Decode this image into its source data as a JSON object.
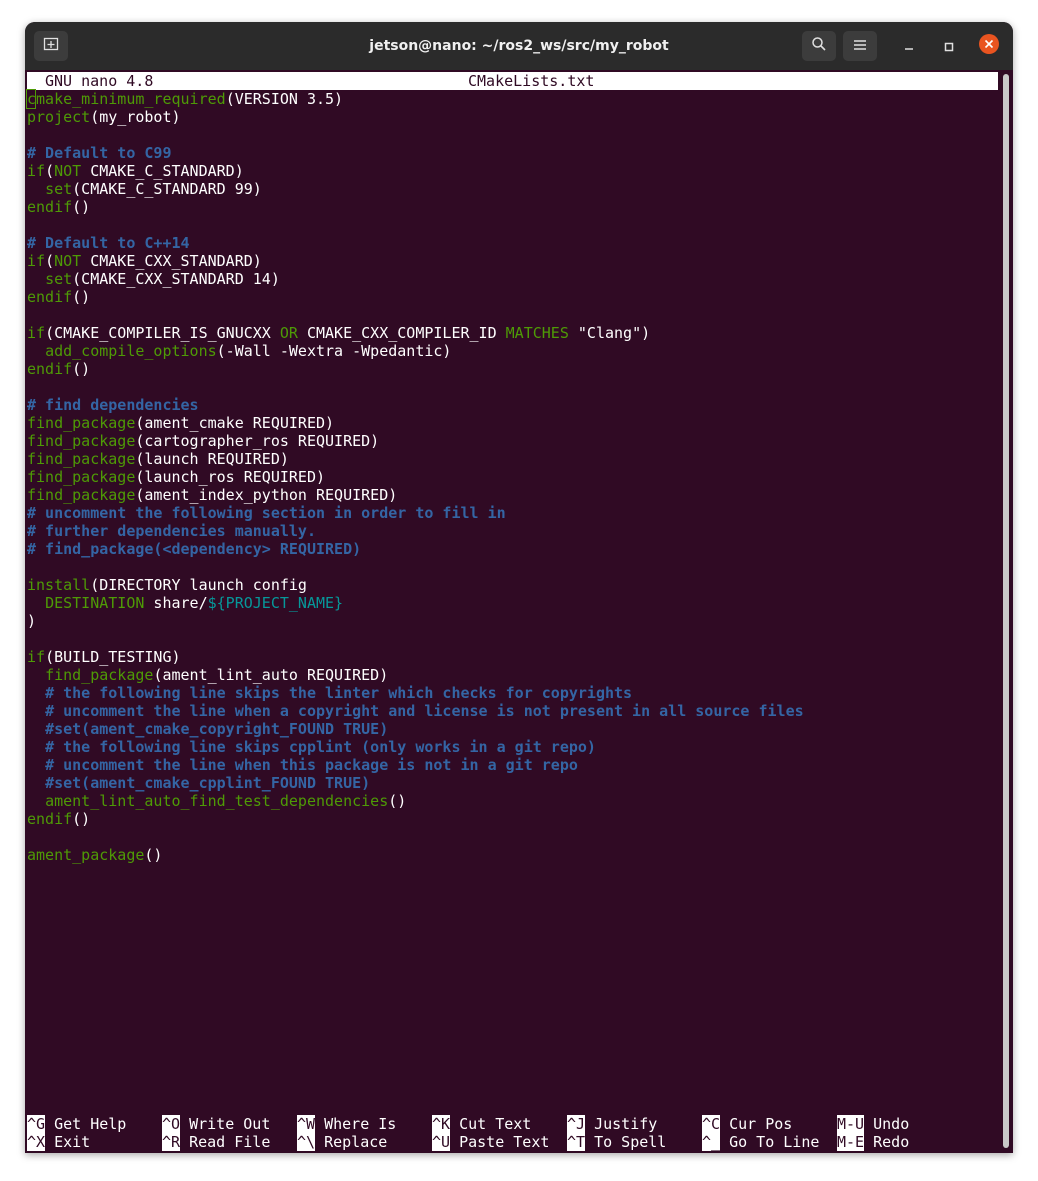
{
  "window": {
    "title": "jetson@nano: ~/ros2_ws/src/my_robot",
    "new_tab_icon": "new-tab-icon",
    "search_icon": "search-icon",
    "menu_icon": "hamburger-menu-icon",
    "minimize_icon": "minimize-icon",
    "maximize_icon": "maximize-icon",
    "close_icon": "close-icon",
    "close_color": "#e95420"
  },
  "nano": {
    "version": "GNU nano 4.8",
    "filename": "CMakeLists.txt"
  },
  "code": {
    "l1a": "cmake_minimum_required",
    "l1b": "(VERSION 3.5)",
    "l2a": "project",
    "l2b": "(my_robot)",
    "l4": "# Default to C99",
    "l5a": "if",
    "l5b": "(",
    "l5c": "NOT",
    "l5d": " CMAKE_C_STANDARD)",
    "l6a": "set",
    "l6b": "(CMAKE_C_STANDARD 99)",
    "l7a": "endif",
    "l7b": "()",
    "l9": "# Default to C++14",
    "l10a": "if",
    "l10b": "(",
    "l10c": "NOT",
    "l10d": " CMAKE_CXX_STANDARD)",
    "l11a": "set",
    "l11b": "(CMAKE_CXX_STANDARD 14)",
    "l12a": "endif",
    "l12b": "()",
    "l14a": "if",
    "l14b": "(CMAKE_COMPILER_IS_GNUCXX ",
    "l14c": "OR",
    "l14d": " CMAKE_CXX_COMPILER_ID ",
    "l14e": "MATCHES",
    "l14f": " \"Clang\")",
    "l15a": "add_compile_options",
    "l15b": "(-Wall -Wextra -Wpedantic)",
    "l16a": "endif",
    "l16b": "()",
    "l18": "# find dependencies",
    "l19a": "find_package",
    "l19b": "(ament_cmake REQUIRED)",
    "l20a": "find_package",
    "l20b": "(cartographer_ros REQUIRED)",
    "l21a": "find_package",
    "l21b": "(launch REQUIRED)",
    "l22a": "find_package",
    "l22b": "(launch_ros REQUIRED)",
    "l23a": "find_package",
    "l23b": "(ament_index_python REQUIRED)",
    "l24": "# uncomment the following section in order to fill in",
    "l25": "# further dependencies manually.",
    "l26": "# find_package(<dependency> REQUIRED)",
    "l28a": "install",
    "l28b": "(DIRECTORY launch config",
    "l29a": "DESTINATION",
    "l29b": " share/",
    "l29c": "${PROJECT_NAME}",
    "l30": ")",
    "l32a": "if",
    "l32b": "(BUILD_TESTING)",
    "l33a": "find_package",
    "l33b": "(ament_lint_auto REQUIRED)",
    "l34": "# the following line skips the linter which checks for copyrights",
    "l35": "# uncomment the line when a copyright and license is not present in all source files",
    "l36": "#set(ament_cmake_copyright_FOUND TRUE)",
    "l37": "# the following line skips cpplint (only works in a git repo)",
    "l38": "# uncomment the line when this package is not in a git repo",
    "l39": "#set(ament_cmake_cpplint_FOUND TRUE)",
    "l40a": "ament_lint_auto_find_test_dependencies",
    "l40b": "()",
    "l41a": "endif",
    "l41b": "()",
    "l43a": "ament_package",
    "l43b": "()"
  },
  "shortcuts": [
    {
      "key": "^G",
      "label": "Get Help"
    },
    {
      "key": "^O",
      "label": "Write Out"
    },
    {
      "key": "^W",
      "label": "Where Is"
    },
    {
      "key": "^K",
      "label": "Cut Text"
    },
    {
      "key": "^J",
      "label": "Justify"
    },
    {
      "key": "^C",
      "label": "Cur Pos"
    },
    {
      "key": "M-U",
      "label": "Undo"
    },
    {
      "key": "^X",
      "label": "Exit"
    },
    {
      "key": "^R",
      "label": "Read File"
    },
    {
      "key": "^\\",
      "label": "Replace"
    },
    {
      "key": "^U",
      "label": "Paste Text"
    },
    {
      "key": "^T",
      "label": "To Spell"
    },
    {
      "key": "^_",
      "label": "Go To Line"
    },
    {
      "key": "M-E",
      "label": "Redo"
    }
  ]
}
